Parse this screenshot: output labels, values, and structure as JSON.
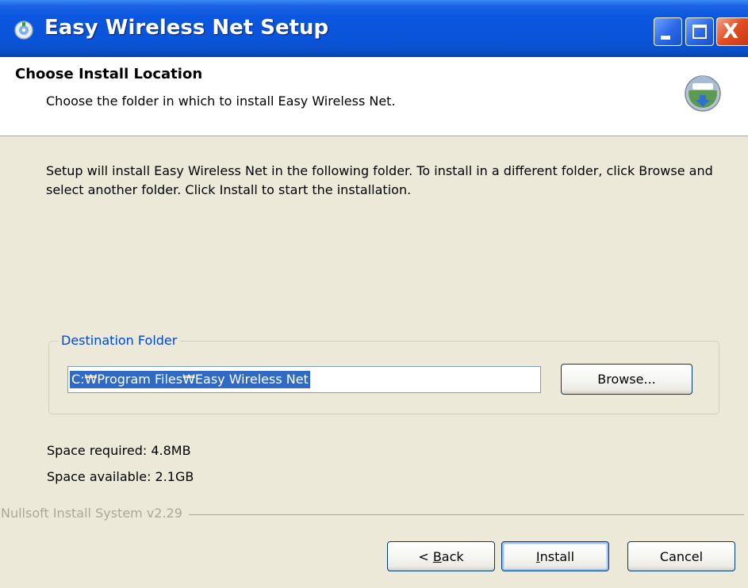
{
  "window": {
    "title": "Easy Wireless Net Setup",
    "title_icon": "installer-icon",
    "controls": [
      "minimize-icon",
      "maximize-icon",
      "close-icon"
    ],
    "close_glyph": "X"
  },
  "header": {
    "title": "Choose Install Location",
    "subtitle": "Choose the folder in which to install Easy Wireless Net.",
    "icon": "install-disc-icon"
  },
  "body": {
    "intro": "Setup will install Easy Wireless Net in the following folder. To install in a different folder, click Browse and select another folder. Click Install to start the installation.",
    "destination": {
      "label": "Destination Folder",
      "path": "C:₩Program Files₩Easy Wireless Net",
      "browse_label": "Browse..."
    },
    "space_required": "Space required: 4.8MB",
    "space_available": "Space available: 2.1GB"
  },
  "footer": {
    "branding": "Nullsoft Install System v2.29",
    "back_prefix": "< ",
    "back_accel": "B",
    "back_rest": "ack",
    "install_accel": "I",
    "install_rest": "nstall",
    "cancel_label": "Cancel"
  },
  "colors": {
    "titlebar": "#0954d7",
    "dialog_bg": "#ece9d8",
    "group_label": "#0046d5",
    "selection": "#316ac5",
    "close_button": "#e24c20"
  }
}
